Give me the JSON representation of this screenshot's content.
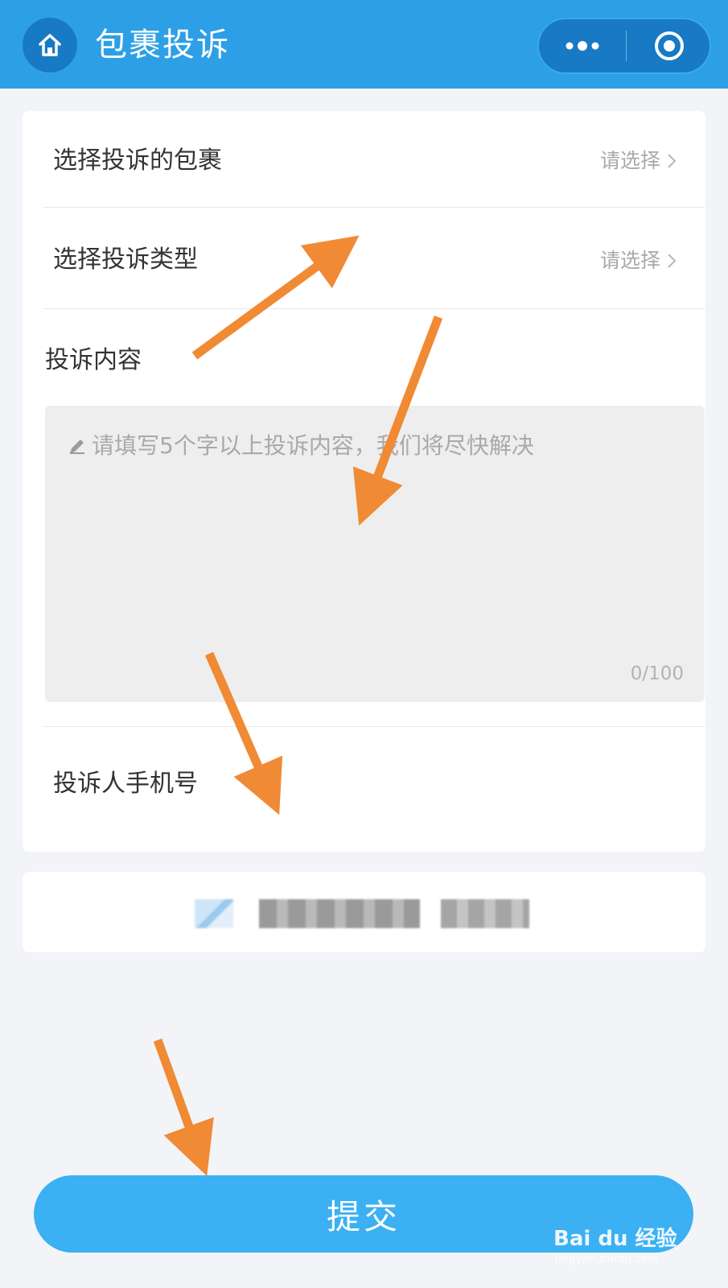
{
  "header": {
    "title": "包裹投诉",
    "bg_color": "#2d9fe6",
    "home_icon": "home-icon",
    "more_icon": "more-dots-icon",
    "close_icon": "target-circle-icon"
  },
  "form": {
    "package_row": {
      "label": "选择投诉的包裹",
      "placeholder": "请选择"
    },
    "type_row": {
      "label": "选择投诉类型",
      "placeholder": "请选择"
    },
    "content": {
      "label": "投诉内容",
      "placeholder": "请填写5个字以上投诉内容，我们将尽快解决",
      "counter": "0/100"
    },
    "phone": {
      "label": "投诉人手机号"
    }
  },
  "submit": {
    "label": "提交",
    "color": "#3bb0f3"
  },
  "watermark": {
    "brand": "Bai du 经验",
    "site": "jingyan.baidu.com"
  },
  "annotation_color": "#f08a34"
}
